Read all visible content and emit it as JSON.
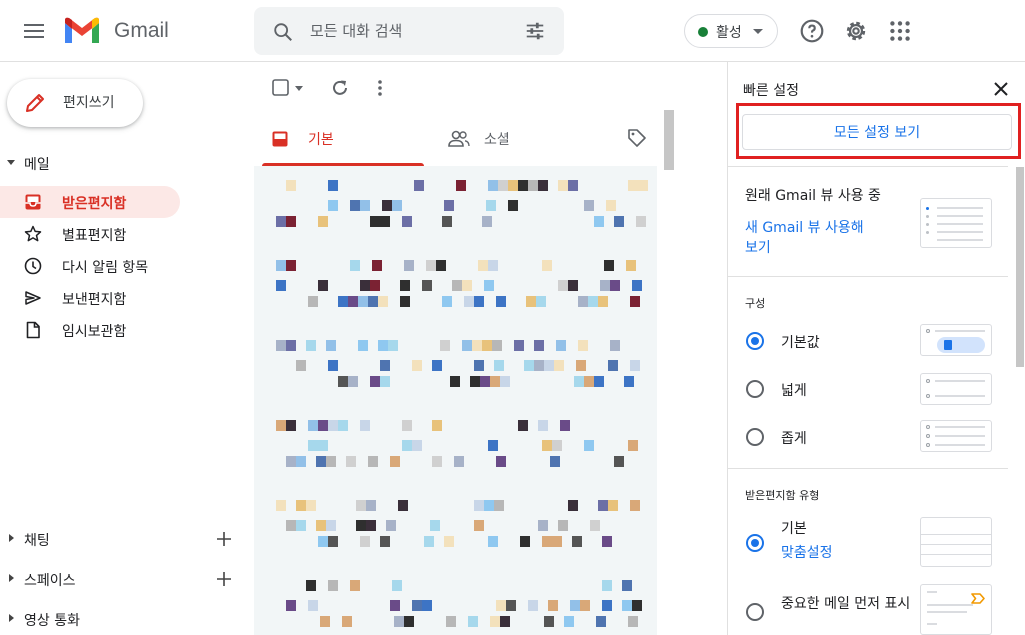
{
  "app": {
    "name": "Gmail"
  },
  "search": {
    "placeholder": "모든 대화 검색"
  },
  "header": {
    "status_label": "활성",
    "status_color": "#188038"
  },
  "compose": {
    "label": "편지쓰기"
  },
  "sidebar": {
    "mail_section": "메일",
    "items": [
      {
        "label": "받은편지함",
        "icon": "inbox-icon",
        "active": true
      },
      {
        "label": "별표편지함",
        "icon": "star-icon",
        "active": false
      },
      {
        "label": "다시 알림 항목",
        "icon": "clock-icon",
        "active": false
      },
      {
        "label": "보낸편지함",
        "icon": "send-icon",
        "active": false
      },
      {
        "label": "임시보관함",
        "icon": "draft-icon",
        "active": false
      }
    ],
    "sections": [
      {
        "label": "채팅"
      },
      {
        "label": "스페이스"
      },
      {
        "label": "영상 통화"
      }
    ]
  },
  "tabs": [
    {
      "label": "기본",
      "icon": "inbox-icon",
      "active": true
    },
    {
      "label": "소셜",
      "icon": "people-icon",
      "active": false
    }
  ],
  "quick_settings": {
    "title": "빠른 설정",
    "all_settings_button": "모든 설정 보기",
    "view_text": "원래 Gmail 뷰 사용 중",
    "view_link_line1": "새 Gmail 뷰 사용해",
    "view_link_line2": "보기",
    "density_title": "구성",
    "density_options": [
      {
        "label": "기본값",
        "checked": true
      },
      {
        "label": "넓게",
        "checked": false
      },
      {
        "label": "좁게",
        "checked": false
      }
    ],
    "inbox_type_title": "받은편지함 유형",
    "inbox_types": [
      {
        "label": "기본",
        "link": "맞춤설정",
        "checked": true
      },
      {
        "label": "중요한 메일 먼저 표시",
        "checked": false
      }
    ]
  },
  "colors": {
    "accent": "#1a73e8",
    "brand_red": "#d93025",
    "highlight": "#e02020"
  }
}
